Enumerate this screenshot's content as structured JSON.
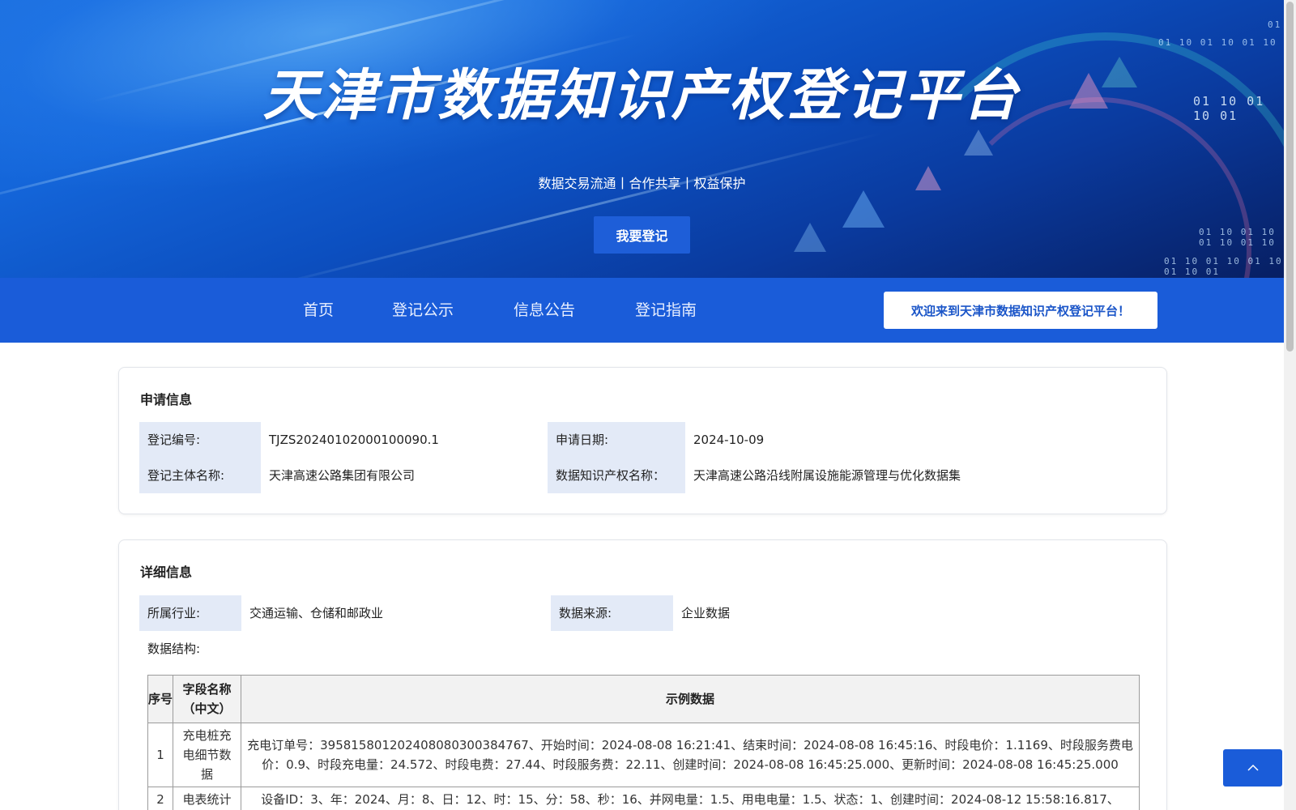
{
  "banner": {
    "title": "天津市数据知识产权登记平台",
    "subtitle": "数据交易流通丨合作共享丨权益保护",
    "register_button": "我要登记",
    "bits": [
      "01 10 01 10 01 10",
      "01 10 01 10 01",
      "01 10 01 10 01 10 01 10",
      "01 10 01 10 01 10 01 10 01",
      "01"
    ]
  },
  "nav": {
    "items": [
      "首页",
      "登记公示",
      "信息公告",
      "登记指南"
    ],
    "welcome": "欢迎来到天津市数据知识产权登记平台！"
  },
  "application": {
    "title": "申请信息",
    "reg_no_label": "登记编号:",
    "reg_no": "TJZS20240102000100090.1",
    "apply_date_label": "申请日期:",
    "apply_date": "2024-10-09",
    "subject_label": "登记主体名称:",
    "subject": "天津高速公路集团有限公司",
    "ip_name_label": "数据知识产权名称：",
    "ip_name": "天津高速公路沿线附属设施能源管理与优化数据集"
  },
  "detail": {
    "title": "详细信息",
    "industry_label": "所属行业:",
    "industry": "交通运输、仓储和邮政业",
    "source_label": "数据来源:",
    "source": "企业数据",
    "structure_label": "数据结构:",
    "table": {
      "headers": [
        "序号",
        "字段名称（中文）",
        "示例数据"
      ],
      "rows": [
        {
          "no": "1",
          "name": "充电桩充电细节数据",
          "sample": "充电订单号：395815801202408080300384767、开始时间：2024-08-08 16:21:41、结束时间：2024-08-08 16:45:16、时段电价：1.1169、时段服务费电价：0.9、时段充电量：24.572、时段电费：27.44、时段服务费：22.11、创建时间：2024-08-08 16:45:25.000、更新时间：2024-08-08 16:45:25.000"
        },
        {
          "no": "2",
          "name": "电表统计",
          "sample": "设备ID：3、年：2024、月：8、日：12、时：15、分：58、秒：16、并网电量：1.5、用电电量：1.5、状态：1、创建时间：2024-08-12 15:58:16.817、"
        }
      ]
    }
  },
  "icons": {
    "back_to_top": "chevron-up-icon"
  },
  "colors": {
    "primary": "#1a5cd9",
    "label_bg": "#e3eaf7",
    "welcome_text": "#1a55c8"
  }
}
